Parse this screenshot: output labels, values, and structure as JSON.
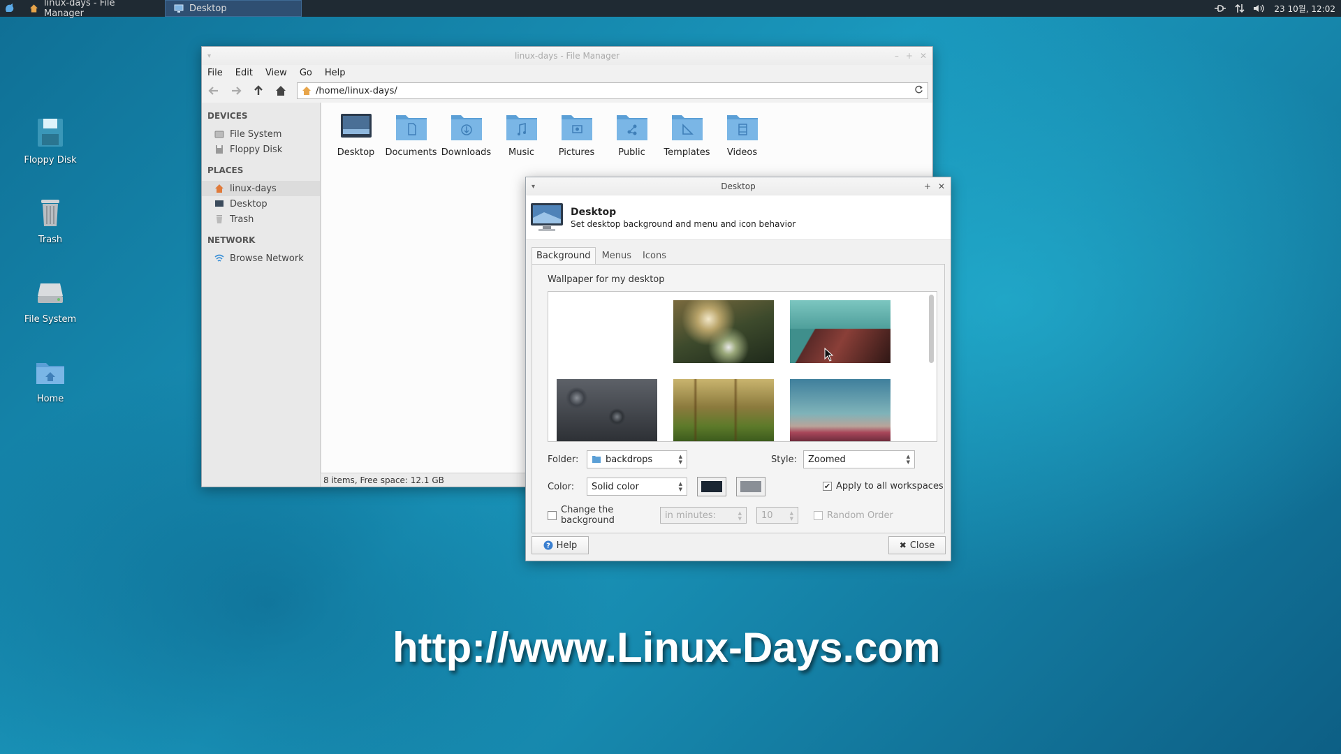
{
  "panel": {
    "tasks": [
      {
        "label": "linux-days - File Manager"
      },
      {
        "label": "Desktop"
      }
    ],
    "clock": "23 10월, 12:02"
  },
  "desktop_icons": [
    {
      "label": "Floppy Disk"
    },
    {
      "label": "Trash"
    },
    {
      "label": "File System"
    },
    {
      "label": "Home"
    }
  ],
  "file_manager": {
    "title": "linux-days - File Manager",
    "menu": [
      "File",
      "Edit",
      "View",
      "Go",
      "Help"
    ],
    "path": "/home/linux-days/",
    "sidebar": {
      "devices_header": "DEVICES",
      "devices": [
        "File System",
        "Floppy Disk"
      ],
      "places_header": "PLACES",
      "places": [
        "linux-days",
        "Desktop",
        "Trash"
      ],
      "network_header": "NETWORK",
      "network": [
        "Browse Network"
      ]
    },
    "items": [
      "Desktop",
      "Documents",
      "Downloads",
      "Music",
      "Pictures",
      "Public",
      "Templates",
      "Videos"
    ],
    "status": "8 items, Free space: 12.1 GB"
  },
  "desktop_dialog": {
    "title": "Desktop",
    "header_title": "Desktop",
    "header_sub": "Set desktop background and menu and icon behavior",
    "tabs": [
      "Background",
      "Menus",
      "Icons"
    ],
    "wallpaper_label": "Wallpaper for my desktop",
    "folder_label": "Folder:",
    "folder_value": "backdrops",
    "style_label": "Style:",
    "style_value": "Zoomed",
    "color_label": "Color:",
    "color_value": "Solid color",
    "color1": "#1b2633",
    "color2": "#8a8f96",
    "apply_all_label": "Apply to all workspaces",
    "change_bg_label": "Change the background",
    "interval_unit": "in minutes:",
    "interval_value": "10",
    "random_label": "Random Order",
    "help_label": "Help",
    "close_label": "Close"
  },
  "watermark": "http://www.Linux-Days.com",
  "colors": {
    "panel": "#1f2a33",
    "accent": "#2f4f72",
    "folder": "#5b9fd6"
  }
}
